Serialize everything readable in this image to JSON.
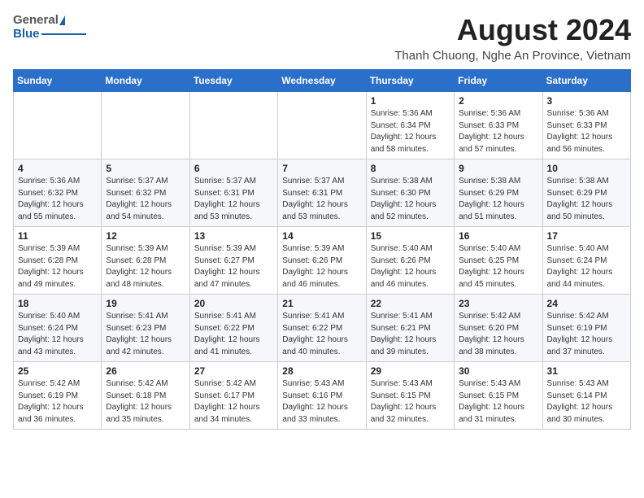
{
  "header": {
    "logo_general": "General",
    "logo_blue": "Blue",
    "month_year": "August 2024",
    "location": "Thanh Chuong, Nghe An Province, Vietnam"
  },
  "days_of_week": [
    "Sunday",
    "Monday",
    "Tuesday",
    "Wednesday",
    "Thursday",
    "Friday",
    "Saturday"
  ],
  "weeks": [
    [
      {
        "day": "",
        "info": ""
      },
      {
        "day": "",
        "info": ""
      },
      {
        "day": "",
        "info": ""
      },
      {
        "day": "",
        "info": ""
      },
      {
        "day": "1",
        "info": "Sunrise: 5:36 AM\nSunset: 6:34 PM\nDaylight: 12 hours\nand 58 minutes."
      },
      {
        "day": "2",
        "info": "Sunrise: 5:36 AM\nSunset: 6:33 PM\nDaylight: 12 hours\nand 57 minutes."
      },
      {
        "day": "3",
        "info": "Sunrise: 5:36 AM\nSunset: 6:33 PM\nDaylight: 12 hours\nand 56 minutes."
      }
    ],
    [
      {
        "day": "4",
        "info": "Sunrise: 5:36 AM\nSunset: 6:32 PM\nDaylight: 12 hours\nand 55 minutes."
      },
      {
        "day": "5",
        "info": "Sunrise: 5:37 AM\nSunset: 6:32 PM\nDaylight: 12 hours\nand 54 minutes."
      },
      {
        "day": "6",
        "info": "Sunrise: 5:37 AM\nSunset: 6:31 PM\nDaylight: 12 hours\nand 53 minutes."
      },
      {
        "day": "7",
        "info": "Sunrise: 5:37 AM\nSunset: 6:31 PM\nDaylight: 12 hours\nand 53 minutes."
      },
      {
        "day": "8",
        "info": "Sunrise: 5:38 AM\nSunset: 6:30 PM\nDaylight: 12 hours\nand 52 minutes."
      },
      {
        "day": "9",
        "info": "Sunrise: 5:38 AM\nSunset: 6:29 PM\nDaylight: 12 hours\nand 51 minutes."
      },
      {
        "day": "10",
        "info": "Sunrise: 5:38 AM\nSunset: 6:29 PM\nDaylight: 12 hours\nand 50 minutes."
      }
    ],
    [
      {
        "day": "11",
        "info": "Sunrise: 5:39 AM\nSunset: 6:28 PM\nDaylight: 12 hours\nand 49 minutes."
      },
      {
        "day": "12",
        "info": "Sunrise: 5:39 AM\nSunset: 6:28 PM\nDaylight: 12 hours\nand 48 minutes."
      },
      {
        "day": "13",
        "info": "Sunrise: 5:39 AM\nSunset: 6:27 PM\nDaylight: 12 hours\nand 47 minutes."
      },
      {
        "day": "14",
        "info": "Sunrise: 5:39 AM\nSunset: 6:26 PM\nDaylight: 12 hours\nand 46 minutes."
      },
      {
        "day": "15",
        "info": "Sunrise: 5:40 AM\nSunset: 6:26 PM\nDaylight: 12 hours\nand 46 minutes."
      },
      {
        "day": "16",
        "info": "Sunrise: 5:40 AM\nSunset: 6:25 PM\nDaylight: 12 hours\nand 45 minutes."
      },
      {
        "day": "17",
        "info": "Sunrise: 5:40 AM\nSunset: 6:24 PM\nDaylight: 12 hours\nand 44 minutes."
      }
    ],
    [
      {
        "day": "18",
        "info": "Sunrise: 5:40 AM\nSunset: 6:24 PM\nDaylight: 12 hours\nand 43 minutes."
      },
      {
        "day": "19",
        "info": "Sunrise: 5:41 AM\nSunset: 6:23 PM\nDaylight: 12 hours\nand 42 minutes."
      },
      {
        "day": "20",
        "info": "Sunrise: 5:41 AM\nSunset: 6:22 PM\nDaylight: 12 hours\nand 41 minutes."
      },
      {
        "day": "21",
        "info": "Sunrise: 5:41 AM\nSunset: 6:22 PM\nDaylight: 12 hours\nand 40 minutes."
      },
      {
        "day": "22",
        "info": "Sunrise: 5:41 AM\nSunset: 6:21 PM\nDaylight: 12 hours\nand 39 minutes."
      },
      {
        "day": "23",
        "info": "Sunrise: 5:42 AM\nSunset: 6:20 PM\nDaylight: 12 hours\nand 38 minutes."
      },
      {
        "day": "24",
        "info": "Sunrise: 5:42 AM\nSunset: 6:19 PM\nDaylight: 12 hours\nand 37 minutes."
      }
    ],
    [
      {
        "day": "25",
        "info": "Sunrise: 5:42 AM\nSunset: 6:19 PM\nDaylight: 12 hours\nand 36 minutes."
      },
      {
        "day": "26",
        "info": "Sunrise: 5:42 AM\nSunset: 6:18 PM\nDaylight: 12 hours\nand 35 minutes."
      },
      {
        "day": "27",
        "info": "Sunrise: 5:42 AM\nSunset: 6:17 PM\nDaylight: 12 hours\nand 34 minutes."
      },
      {
        "day": "28",
        "info": "Sunrise: 5:43 AM\nSunset: 6:16 PM\nDaylight: 12 hours\nand 33 minutes."
      },
      {
        "day": "29",
        "info": "Sunrise: 5:43 AM\nSunset: 6:15 PM\nDaylight: 12 hours\nand 32 minutes."
      },
      {
        "day": "30",
        "info": "Sunrise: 5:43 AM\nSunset: 6:15 PM\nDaylight: 12 hours\nand 31 minutes."
      },
      {
        "day": "31",
        "info": "Sunrise: 5:43 AM\nSunset: 6:14 PM\nDaylight: 12 hours\nand 30 minutes."
      }
    ]
  ]
}
